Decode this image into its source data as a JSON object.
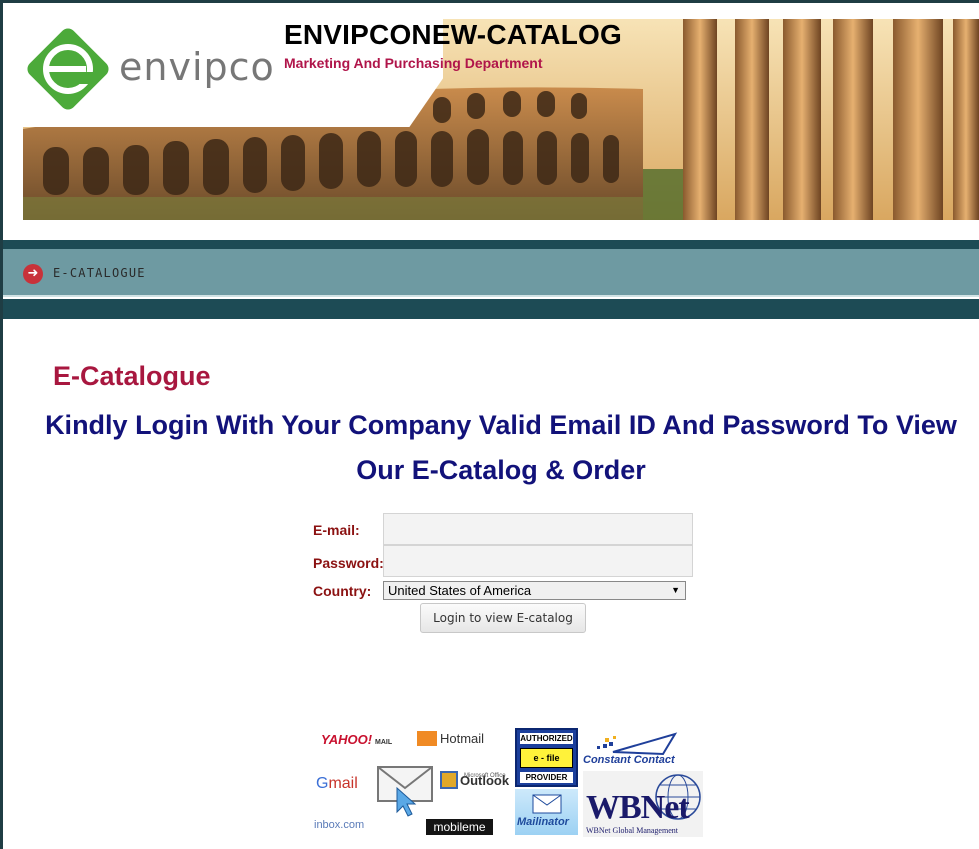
{
  "header": {
    "logo_text": "envipco",
    "site_title": "ENVIPCONEW-CATALOG",
    "subtitle": "Marketing And Purchasing Department"
  },
  "nav": {
    "items": [
      {
        "label": "E-CATALOGUE",
        "icon": "arrow-right-circle-icon"
      }
    ]
  },
  "main": {
    "title": "E-Catalogue",
    "instruction": "Kindly Login With Your Company Valid Email ID And Password To View Our E-Catalog & Order"
  },
  "form": {
    "email_label": "E-mail:",
    "email_value": "",
    "password_label": "Password:",
    "password_value": "",
    "country_label": "Country:",
    "country_value": "United States of America",
    "submit_label": "Login to view E-catalog"
  },
  "logos": {
    "yahoo": "YAHOO!",
    "yahoo_mail": "MAIL",
    "hotmail": "Hotmail",
    "gmail_g": "G",
    "gmail_rest": "mail",
    "outlook_small": "Microsoft Office",
    "outlook": "Outlook",
    "authorized_1": "AUTHORIZED",
    "authorized_2": "e - file",
    "authorized_3": "PROVIDER",
    "constant_contact": "Constant Contact",
    "inbox": "inbox.com",
    "mobileme": "mobileme",
    "mailinator": "Mailinator",
    "wbnet": "WBNet",
    "wbnet_sub": "WBNet Global Management"
  },
  "colors": {
    "accent_red": "#a8173f",
    "heading_navy": "#12127a",
    "nav_teal": "#6e9aa2",
    "logo_green": "#4caa3a"
  }
}
